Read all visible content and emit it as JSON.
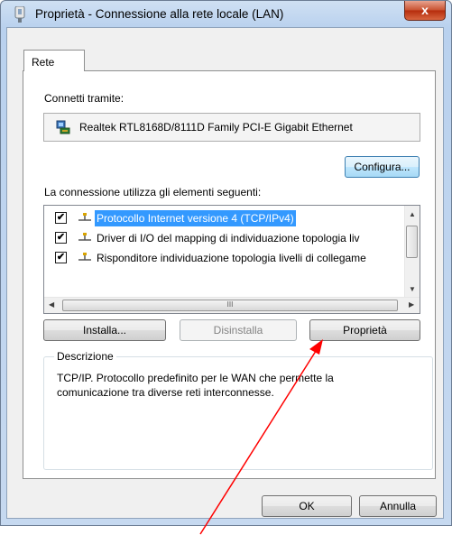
{
  "window": {
    "title": "Proprietà - Connessione alla rete locale (LAN)",
    "close_symbol": "x"
  },
  "tabs": [
    {
      "label": "Rete"
    }
  ],
  "connect_via": {
    "label": "Connetti tramite:",
    "adapter_name": "Realtek RTL8168D/8111D Family PCI-E Gigabit Ethernet",
    "adapter_icon": "network-adapter-icon"
  },
  "configure_button": {
    "label": "Configura..."
  },
  "items_section": {
    "label": "La connessione utilizza gli elementi seguenti:",
    "items": [
      {
        "label": "Protocollo Internet versione 4 (TCP/IPv4)",
        "checked": true,
        "selected": true,
        "icon": "protocol-icon"
      },
      {
        "label": "Driver di I/O del mapping di individuazione topologia liv",
        "checked": true,
        "selected": false,
        "icon": "protocol-icon"
      },
      {
        "label": "Risponditore individuazione topologia livelli di collegame",
        "checked": true,
        "selected": false,
        "icon": "protocol-icon"
      }
    ],
    "hscroll_grip": "III"
  },
  "buttons": {
    "install": "Installa...",
    "uninstall": "Disinstalla",
    "properties": "Proprietà"
  },
  "description": {
    "title": "Descrizione",
    "text": "TCP/IP. Protocollo predefinito per le WAN che permette la comunicazione tra diverse reti interconnesse."
  },
  "dialog_buttons": {
    "ok": "OK",
    "cancel": "Annulla"
  },
  "colors": {
    "selection": "#3399ff",
    "annotation_arrow": "#ff0000"
  }
}
